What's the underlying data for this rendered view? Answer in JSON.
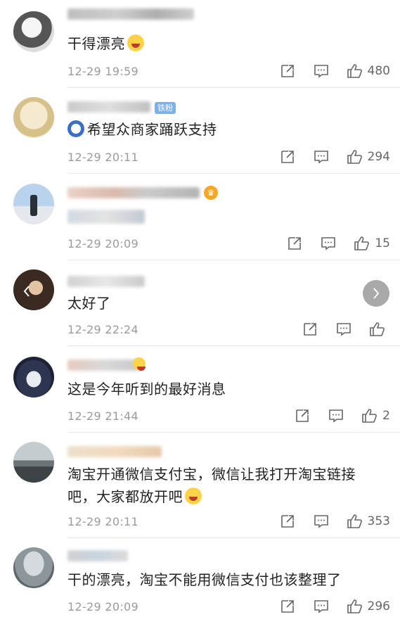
{
  "comments": [
    {
      "text": "干得漂亮",
      "time": "12-29 19:59",
      "likes": "480",
      "avatar_colors": [
        "#e8e8e8",
        "#4a4a4a"
      ],
      "trailing_emoji": "grin-sweat-emoji"
    },
    {
      "text": "希望众商家踊跃支持",
      "time": "12-29 20:11",
      "likes": "294",
      "badge": "铁粉",
      "avatar_colors": [
        "#f1e6c8",
        "#c9a86b"
      ]
    },
    {
      "text": "",
      "time": "12-29 20:09",
      "likes": "15",
      "avatar_colors": [
        "#a7c4e0",
        "#36404a"
      ]
    },
    {
      "text": "太好了",
      "time": "12-29 22:24",
      "likes": "",
      "avatar_colors": [
        "#3a2a22",
        "#d9b58e"
      ]
    },
    {
      "text": "这是今年听到的最好消息",
      "time": "12-29 21:44",
      "likes": "2",
      "avatar_colors": [
        "#2d3550",
        "#d0d4dc"
      ]
    },
    {
      "text": "淘宝开通微信支付宝，微信让我打开淘宝链接吧，大家都放开吧",
      "time": "12-29 20:11",
      "likes": "353",
      "avatar_colors": [
        "#9da4a8",
        "#555a5c"
      ],
      "trailing_emoji": "laugh-cry-emoji"
    },
    {
      "text": "干的漂亮，淘宝不能用微信支付也该整理了",
      "time": "12-29 20:09",
      "likes": "296",
      "avatar_colors": [
        "#b7c0c6",
        "#6b757b"
      ]
    }
  ],
  "icons": {
    "share": "share-icon",
    "reply": "comment-icon",
    "like": "thumbs-up-icon",
    "next": "chevron-right-icon"
  },
  "colors": {
    "text": "#222222",
    "meta": "#9b9b9b",
    "badge": "#7eb2e6",
    "divider": "#e8e8e8"
  }
}
